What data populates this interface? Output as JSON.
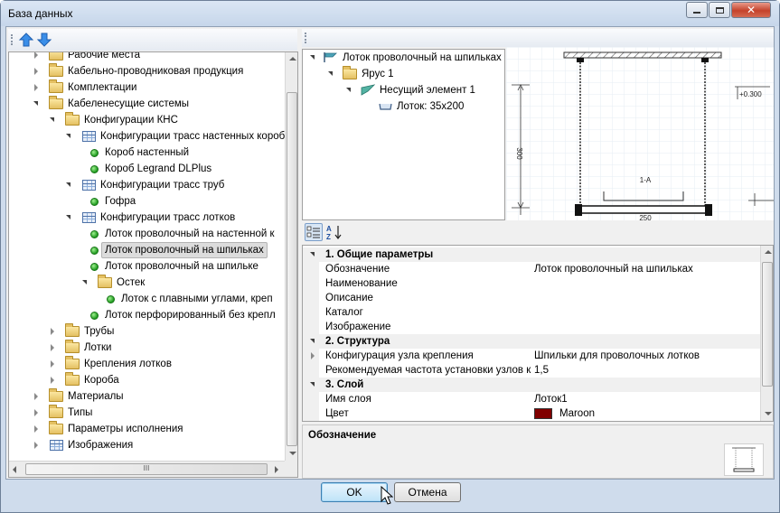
{
  "window": {
    "title": "База данных"
  },
  "toolbar": {
    "up_icon": "arrow-up-icon",
    "down_icon": "arrow-down-icon"
  },
  "tree": {
    "items": [
      {
        "label": "Рабочие места"
      },
      {
        "label": "Кабельно-проводниковая продукция"
      },
      {
        "label": "Комплектации"
      },
      {
        "label": "Кабеленесущие системы"
      },
      {
        "label": "Конфигурации КНС"
      },
      {
        "label": "Конфигурации трасс настенных коробок"
      },
      {
        "label": "Короб настенный"
      },
      {
        "label": "Короб Legrand DLPlus"
      },
      {
        "label": "Конфигурации трасс труб"
      },
      {
        "label": "Гофра"
      },
      {
        "label": "Конфигурации трасс лотков"
      },
      {
        "label": "Лоток проволочный на настенной к"
      },
      {
        "label": "Лоток проволочный на шпильках"
      },
      {
        "label": "Лоток проволочный на шпильке"
      },
      {
        "label": "Остек"
      },
      {
        "label": "Лоток с плавными углами, креп"
      },
      {
        "label": "Лоток перфорированный без крепл"
      },
      {
        "label": "Трубы"
      },
      {
        "label": "Лотки"
      },
      {
        "label": "Крепления лотков"
      },
      {
        "label": "Короба"
      },
      {
        "label": "Материалы"
      },
      {
        "label": "Типы"
      },
      {
        "label": "Параметры исполнения"
      },
      {
        "label": "Изображения"
      }
    ],
    "hscroll_grip": "III"
  },
  "structure": {
    "items": [
      {
        "label": "Лоток проволочный на шпильках"
      },
      {
        "label": "Ярус 1"
      },
      {
        "label": "Несущий элемент 1"
      },
      {
        "label": "Лоток: 35x200"
      }
    ]
  },
  "drawing": {
    "dim_height": "300",
    "elevation": "+0.300",
    "section": "1-A",
    "dim_width": "250"
  },
  "props": {
    "rows": [
      {
        "name": "1. Общие параметры",
        "value": ""
      },
      {
        "name": "Обозначение",
        "value": "Лоток проволочный на шпильках"
      },
      {
        "name": "Наименование",
        "value": ""
      },
      {
        "name": "Описание",
        "value": ""
      },
      {
        "name": "Каталог",
        "value": ""
      },
      {
        "name": "Изображение",
        "value": ""
      },
      {
        "name": "2. Структура",
        "value": ""
      },
      {
        "name": "Конфигурация узла крепления",
        "value": "Шпильки для проволочных лотков"
      },
      {
        "name": "Рекомендуемая частота установки узлов кр",
        "value": "1,5"
      },
      {
        "name": "3. Слой",
        "value": ""
      },
      {
        "name": "Имя слоя",
        "value": "Лоток1"
      },
      {
        "name": "Цвет",
        "value": "Maroon"
      }
    ],
    "color_swatch": "#800000"
  },
  "description": {
    "title": "Обозначение"
  },
  "buttons": {
    "ok": "OK",
    "cancel": "Отмена"
  }
}
